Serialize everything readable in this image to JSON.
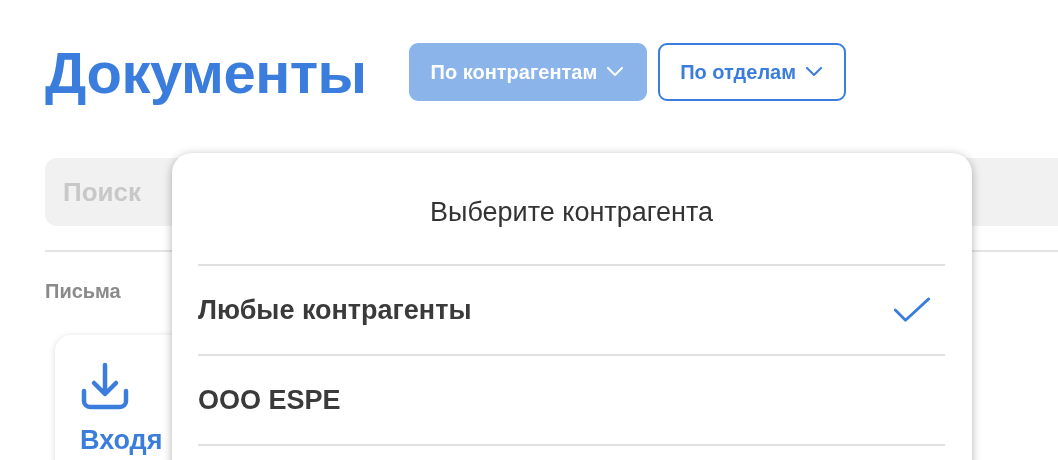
{
  "title": "Документы",
  "filters": [
    {
      "label": "По контрагентам",
      "selected": true
    },
    {
      "label": "По отделам",
      "selected": false
    }
  ],
  "search": {
    "placeholder": "Поиск"
  },
  "section_label": "Письма",
  "cards": [
    {
      "label": "Входя"
    }
  ],
  "dropdown": {
    "title": "Выберите контрагента",
    "options": [
      {
        "label": "Любые контрагенты",
        "selected": true
      },
      {
        "label": "OOO ESPE",
        "selected": false
      }
    ]
  }
}
